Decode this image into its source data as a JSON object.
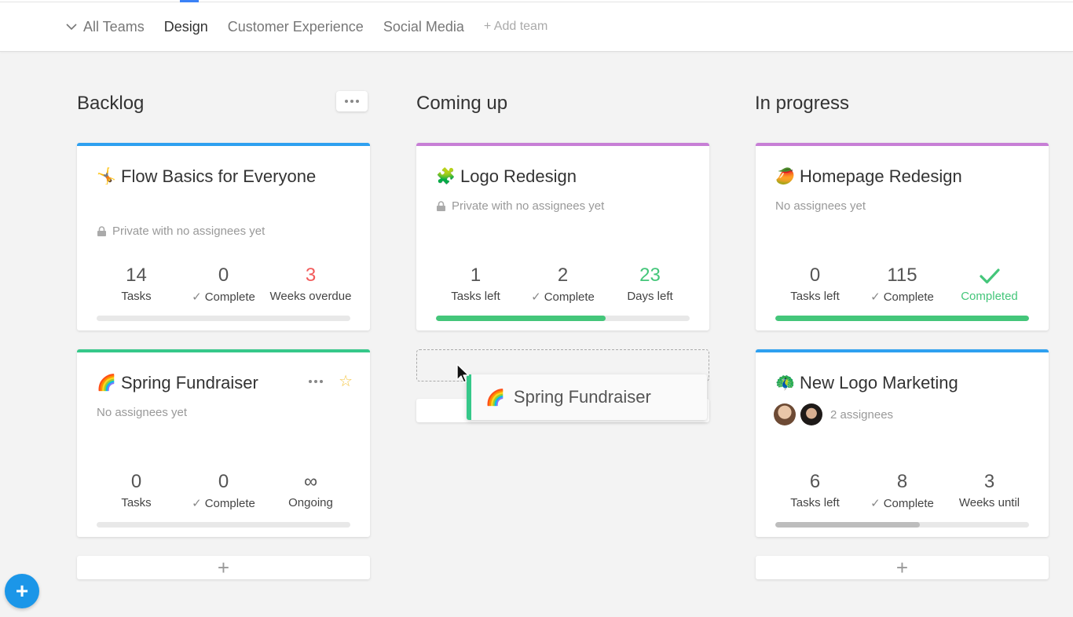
{
  "nav": {
    "all_teams": "All Teams",
    "tabs": [
      "Design",
      "Customer Experience",
      "Social Media"
    ],
    "add_team": "+ Add team"
  },
  "columns": [
    {
      "title": "Backlog"
    },
    {
      "title": "Coming up"
    },
    {
      "title": "In progress"
    }
  ],
  "cards": {
    "flow_basics": {
      "emoji": "🤸",
      "title": "Flow Basics for Everyone",
      "meta": "Private with no assignees yet",
      "accent": "#2ea0f0",
      "stats": [
        {
          "num": "14",
          "label": "Tasks"
        },
        {
          "num": "0",
          "label": "Complete"
        },
        {
          "num": "3",
          "label": "Weeks overdue"
        }
      ],
      "progress": 0
    },
    "spring": {
      "emoji": "🌈",
      "title": "Spring Fundraiser",
      "meta": "No assignees yet",
      "accent": "#36c88a",
      "stats": [
        {
          "num": "0",
          "label": "Tasks"
        },
        {
          "num": "0",
          "label": "Complete"
        },
        {
          "num": "∞",
          "label": "Ongoing"
        }
      ],
      "progress": 0
    },
    "logo": {
      "emoji": "🧩",
      "title": "Logo Redesign",
      "meta": "Private with no assignees yet",
      "accent": "#c77ed6",
      "stats": [
        {
          "num": "1",
          "label": "Tasks left"
        },
        {
          "num": "2",
          "label": "Complete"
        },
        {
          "num": "23",
          "label": "Days left"
        }
      ],
      "progress": 0.67
    },
    "homepage": {
      "emoji": "🥭",
      "title": "Homepage Redesign",
      "meta": "No assignees yet",
      "accent": "#c77ed6",
      "stats": [
        {
          "num": "0",
          "label": "Tasks left"
        },
        {
          "num": "115",
          "label": "Complete"
        },
        {
          "num": "✓",
          "label": "Completed"
        }
      ],
      "progress": 1.0
    },
    "newlogo": {
      "emoji": "🦚",
      "title": "New Logo Marketing",
      "meta": "2 assignees",
      "accent": "#2ea0f0",
      "stats": [
        {
          "num": "6",
          "label": "Tasks left"
        },
        {
          "num": "8",
          "label": "Complete"
        },
        {
          "num": "3",
          "label": "Weeks until"
        }
      ],
      "progress": 0.57
    }
  },
  "drag": {
    "emoji": "🌈",
    "title": "Spring Fundraiser"
  },
  "add_symbol": "+",
  "fab_symbol": "+",
  "colors": {
    "green": "#44c67a",
    "red": "#f25a5a",
    "blue": "#1b96e8",
    "gray_bar": "#bdbdbd"
  }
}
